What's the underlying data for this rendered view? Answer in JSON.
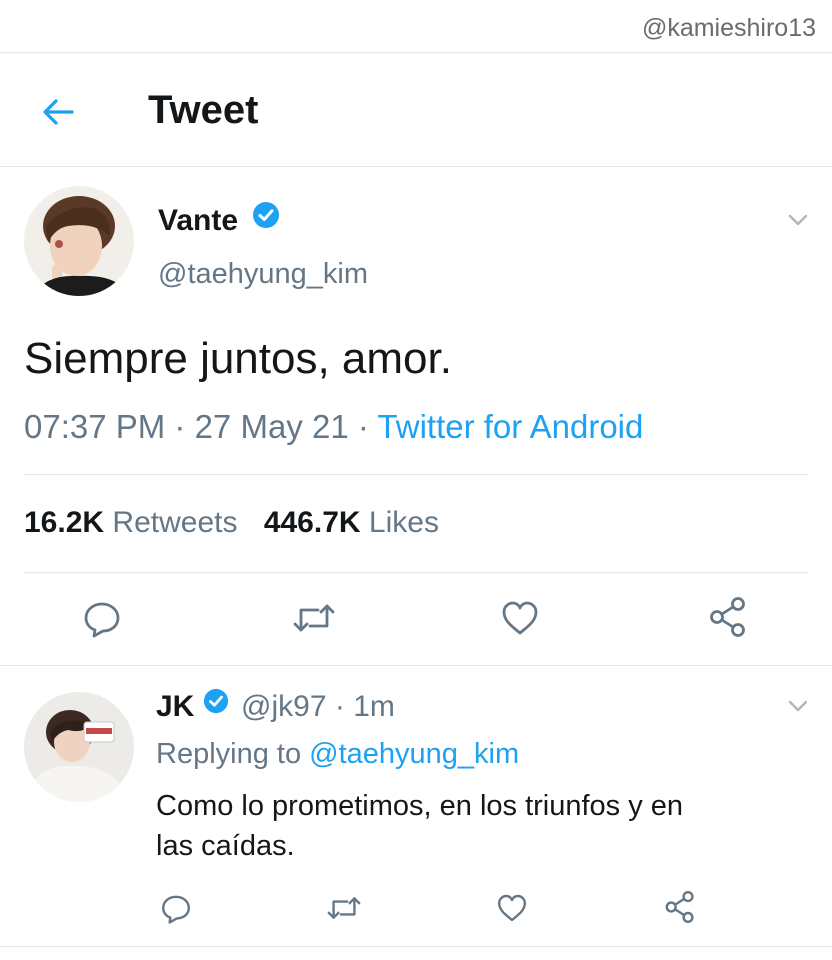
{
  "watermark": "@kamieshiro13",
  "header": {
    "title": "Tweet"
  },
  "tweet": {
    "name": "Vante",
    "handle": "@taehyung_kim",
    "text": "Siempre juntos, amor.",
    "time": "07:37 PM",
    "sep1": " · ",
    "date": "27 May 21",
    "sep2": " · ",
    "source": "Twitter for Android",
    "retweets_count": "16.2K",
    "retweets_label": "Retweets",
    "likes_count": "446.7K",
    "likes_label": "Likes"
  },
  "reply": {
    "name": "JK",
    "handle": "@jk97",
    "sep": " · ",
    "time": "1m",
    "replying_prefix": "Replying to ",
    "replying_handle": "@taehyung_kim",
    "text_line1": "Como lo prometimos, en los triunfos y en",
    "text_line2": "las caídas."
  },
  "icons": [
    "back-arrow-icon",
    "verified-badge-icon",
    "chevron-down-icon",
    "reply-icon",
    "retweet-icon",
    "like-icon",
    "share-icon"
  ],
  "colors": {
    "accent": "#1da1f2",
    "muted": "#657786",
    "divider": "#e1e8ed"
  }
}
